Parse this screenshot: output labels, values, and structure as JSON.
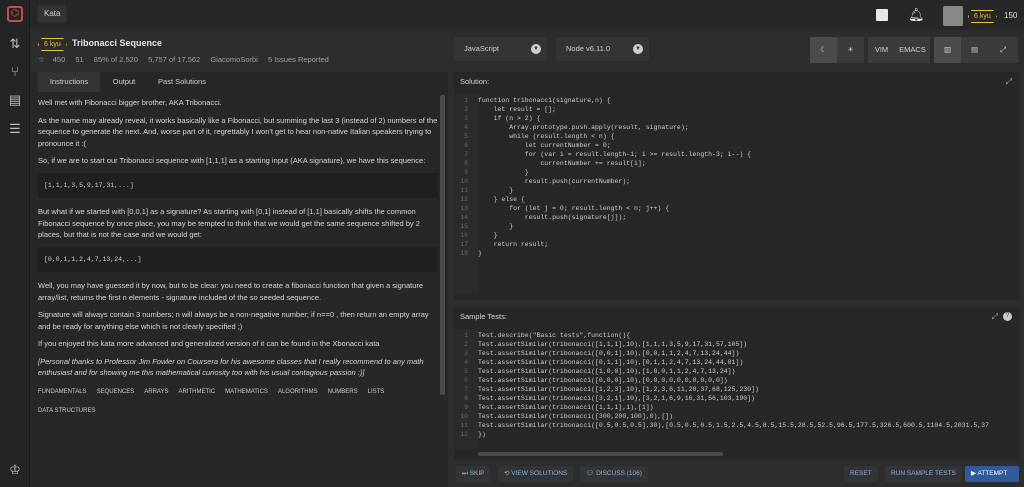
{
  "topbar": {
    "crumb": "Kata",
    "rank_badge": "6 kyu",
    "honor": "150"
  },
  "kata": {
    "rank": "6 kyu",
    "title": "Tribonacci Sequence",
    "votes": "450",
    "favorites": "51",
    "satisfaction": "85% of 2,520",
    "completed": "5,757 of 17,562",
    "author": "GiacomoSorbi",
    "issues": "5 Issues Reported"
  },
  "editor": {
    "language": "JavaScript",
    "version": "Node v6.11.0",
    "vim": "VIM",
    "emacs": "EMACS"
  },
  "tabs": [
    "Instructions",
    "Output",
    "Past Solutions"
  ],
  "description": {
    "p1": "Well met with Fibonacci bigger brother, AKA Tribonacci.",
    "p2": "As the name may already reveal, it works basically like a Fibonacci, but summing the last 3 (instead of 2) numbers of the sequence to generate the next. And, worse part of it, regrettably I won't get to hear non-native Italian speakers trying to pronounce it :(",
    "p3": "So, if we are to start our Tribonacci sequence with [1,1,1] as a starting input (AKA signature), we have this sequence:",
    "code1": "[1,1,1,3,5,9,17,31,...]",
    "p4": "But what if we started with [0,0,1] as a signature? As starting with [0,1] instead of [1,1] basically shifts the common Fibonacci sequence by once place, you may be tempted to think that we would get the same sequence shifted by 2 places, but that is not the case and we would get:",
    "code2": "[0,0,1,1,2,4,7,13,24,...]",
    "p5": "Well, you may have guessed it by now, but to be clear: you need to create a fibonacci function that given a signature array/list, returns the first n elements - signature included of the so seeded sequence.",
    "p6": "Signature will always contain 3 numbers; n will always be a non-negative number; if n==0 , then return an empty array and be ready for anything else which is not clearly specified ;)",
    "p7": "If you enjoyed this kata more advanced and generalized version of it can be found in the Xbonacci kata",
    "p8": "[Personal thanks to Professor Jim Fowler on Coursera for his awesome classes that I really recommend to any math enthusiast and for showing me this mathematical curiosity too with his usual contagious passion :)]"
  },
  "tags": [
    "FUNDAMENTALS",
    "SEQUENCES",
    "ARRAYS",
    "ARITHMETIC",
    "MATHEMATICS",
    "ALGORITHMS",
    "NUMBERS",
    "LISTS",
    "DATA STRUCTURES"
  ],
  "solution": {
    "label": "Solution:",
    "lines": [
      "function tribonacci(signature,n) {",
      "    let result = [];",
      "    if (n > 2) {",
      "        Array.prototype.push.apply(result, signature);",
      "        while (result.length < n) {",
      "            let currentNumber = 0;",
      "            for (var i = result.length-1; i >= result.length-3; i--) {",
      "                currentNumber += result[i];",
      "            }",
      "            result.push(currentNumber);",
      "        }",
      "    } else {",
      "        for (let j = 0; result.length < n; j++) {",
      "            result.push(signature[j]);",
      "        }",
      "    }",
      "    return result;",
      "}"
    ]
  },
  "tests": {
    "label": "Sample Tests:",
    "lines": [
      "Test.describe(\"Basic tests\",function(){",
      "Test.assertSimilar(tribonacci([1,1,1],10),[1,1,1,3,5,9,17,31,57,105])",
      "Test.assertSimilar(tribonacci([0,0,1],10),[0,0,1,1,2,4,7,13,24,44])",
      "Test.assertSimilar(tribonacci([0,1,1],10),[0,1,1,2,4,7,13,24,44,81])",
      "Test.assertSimilar(tribonacci([1,0,0],10),[1,0,0,1,1,2,4,7,13,24])",
      "Test.assertSimilar(tribonacci([0,0,0],10),[0,0,0,0,0,0,0,0,0,0])",
      "Test.assertSimilar(tribonacci([1,2,3],10),[1,2,3,6,11,20,37,68,125,230])",
      "Test.assertSimilar(tribonacci([3,2,1],10),[3,2,1,6,9,16,31,56,103,190])",
      "Test.assertSimilar(tribonacci([1,1,1],1),[1])",
      "Test.assertSimilar(tribonacci([300,200,100],0),[])",
      "Test.assertSimilar(tribonacci([0.5,0.5,0.5],30),[0.5,0.5,0.5,1.5,2.5,4.5,8.5,15.5,28.5,52.5,96.5,177.5,326.5,600.5,1104.5,2031.5,37",
      "})"
    ]
  },
  "actions": {
    "skip": "SKIP",
    "view_solutions": "VIEW SOLUTIONS",
    "discuss": "DISCUSS (106)",
    "reset": "RESET",
    "run_tests": "RUN SAMPLE TESTS",
    "attempt": "ATTEMPT"
  }
}
